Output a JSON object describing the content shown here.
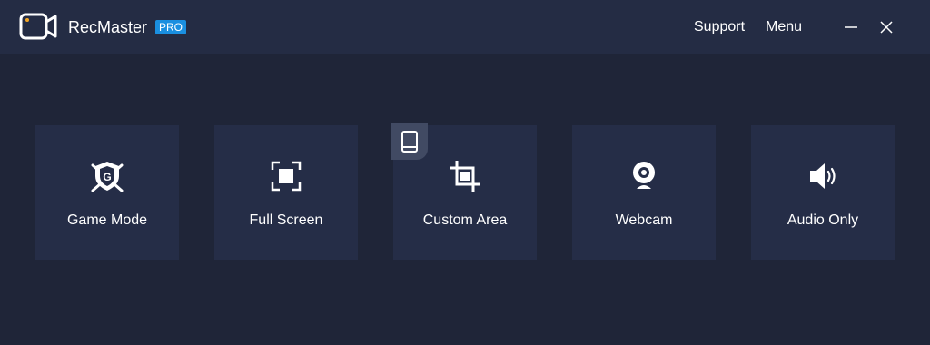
{
  "app": {
    "name": "RecMaster",
    "badge": "PRO"
  },
  "header": {
    "support_label": "Support",
    "menu_label": "Menu"
  },
  "modes": [
    {
      "label": "Game Mode",
      "icon": "game-shield-icon"
    },
    {
      "label": "Full Screen",
      "icon": "fullscreen-icon"
    },
    {
      "label": "Custom Area",
      "icon": "crop-icon"
    },
    {
      "label": "Webcam",
      "icon": "webcam-icon"
    },
    {
      "label": "Audio Only",
      "icon": "speaker-icon"
    }
  ],
  "colors": {
    "background": "#1f2538",
    "titlebar": "#242c44",
    "card": "#252d47",
    "pro_badge": "#1a8fe0",
    "accent_dot": "#f5a623"
  }
}
